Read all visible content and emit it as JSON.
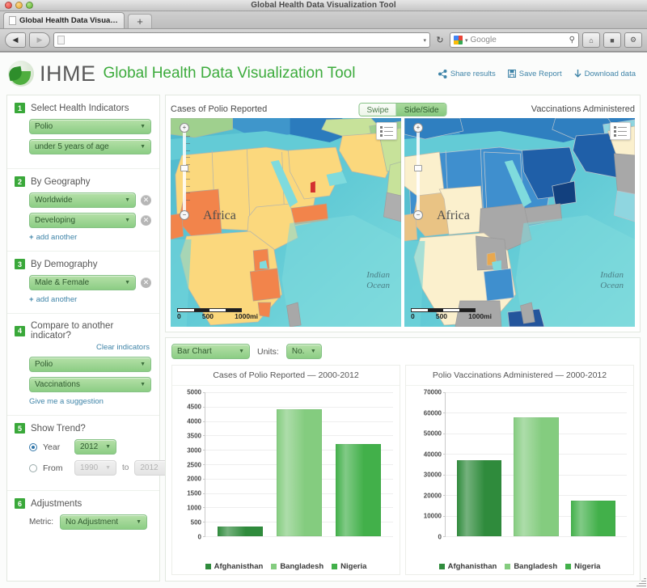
{
  "window": {
    "title": "Global Health Data Visualization Tool",
    "tab_label": "Global Health Data Visualizatio...",
    "new_tab": "+",
    "back": "◀",
    "forward": "▶",
    "url_value": "",
    "reload": "↻",
    "search_placeholder": "Google",
    "home": "⌂",
    "caret": "▾"
  },
  "header": {
    "brand": "IHME",
    "brand_sub": "Global Health Data Visualization Tool",
    "links": [
      {
        "label": "Share results",
        "icon": "share-icon"
      },
      {
        "label": "Save Report",
        "icon": "save-icon"
      },
      {
        "label": "Download data",
        "icon": "download-icon"
      }
    ]
  },
  "sidebar": {
    "steps": [
      {
        "num": "1",
        "title": "Select Health Indicators",
        "selects": [
          {
            "value": "Polio",
            "removable": false
          },
          {
            "value": "under 5 years of age",
            "removable": false
          }
        ]
      },
      {
        "num": "2",
        "title": "By Geography",
        "selects": [
          {
            "value": "Worldwide",
            "removable": true
          },
          {
            "value": "Developing",
            "removable": true
          }
        ],
        "add_label": "add another"
      },
      {
        "num": "3",
        "title": "By Demography",
        "selects": [
          {
            "value": "Male & Female",
            "removable": true
          }
        ],
        "add_label": "add another"
      },
      {
        "num": "4",
        "title": "Compare to another indicator?",
        "clear_label": "Clear indicators",
        "selects": [
          {
            "value": "Polio",
            "removable": false
          },
          {
            "value": "Vaccinations",
            "removable": false
          }
        ],
        "suggest_label": "Give me a suggestion"
      },
      {
        "num": "5",
        "title": "Show Trend?",
        "year_radio_label": "Year",
        "year_value": "2012",
        "year_selected": true,
        "from_radio_label": "From",
        "from_value": "1990",
        "to_label": "to",
        "to_value": "2012"
      },
      {
        "num": "6",
        "title": "Adjustments",
        "metric_label": "Metric:",
        "metric_value": "No Adjustment"
      }
    ]
  },
  "maps": {
    "left_title": "Cases of Polio Reported",
    "right_title": "Vaccinations Administered",
    "view_toggle": {
      "swipe": "Swipe",
      "side": "Side/Side",
      "active": "Side/Side"
    },
    "continent_label": "Africa",
    "ocean_label": "Indian\nOcean",
    "scale": {
      "zero": "0",
      "mid": "500",
      "max": "1000mi"
    },
    "zoom_in": "+",
    "zoom_out": "−",
    "legend_button": "map-legend-icon"
  },
  "chart_controls": {
    "chart_type": "Bar Chart",
    "units_label": "Units:",
    "units_value": "No."
  },
  "chart_data": [
    {
      "type": "bar",
      "title": "Cases of Polio Reported — 2000-2012",
      "categories": [
        "Afghanisthan",
        "Bangladesh",
        "Nigeria"
      ],
      "values": [
        330,
        4400,
        3200
      ],
      "colors": [
        "#2f8b3c",
        "#84cc7f",
        "#42b04a"
      ],
      "xlabel": "",
      "ylabel": "",
      "ylim": [
        0,
        5000
      ],
      "yticks": [
        0,
        500,
        1000,
        1500,
        2000,
        2500,
        3000,
        3500,
        4000,
        4500,
        5000
      ],
      "grid": true,
      "legend_position": "bottom"
    },
    {
      "type": "bar",
      "title": "Polio Vaccinations Administered — 2000-2012",
      "categories": [
        "Afghanisthan",
        "Bangladesh",
        "Nigeria"
      ],
      "values": [
        37000,
        58000,
        17500
      ],
      "colors": [
        "#2f8b3c",
        "#84cc7f",
        "#42b04a"
      ],
      "xlabel": "",
      "ylabel": "",
      "ylim": [
        0,
        70000
      ],
      "yticks": [
        0,
        10000,
        20000,
        30000,
        40000,
        50000,
        60000,
        70000
      ],
      "grid": true,
      "legend_position": "bottom"
    }
  ],
  "theme": {
    "accent_green": "#3aa83a",
    "link_blue": "#3f84a8",
    "bar_dark": "#2f8b3c",
    "bar_light": "#84cc7f",
    "bar_mid": "#42b04a"
  }
}
